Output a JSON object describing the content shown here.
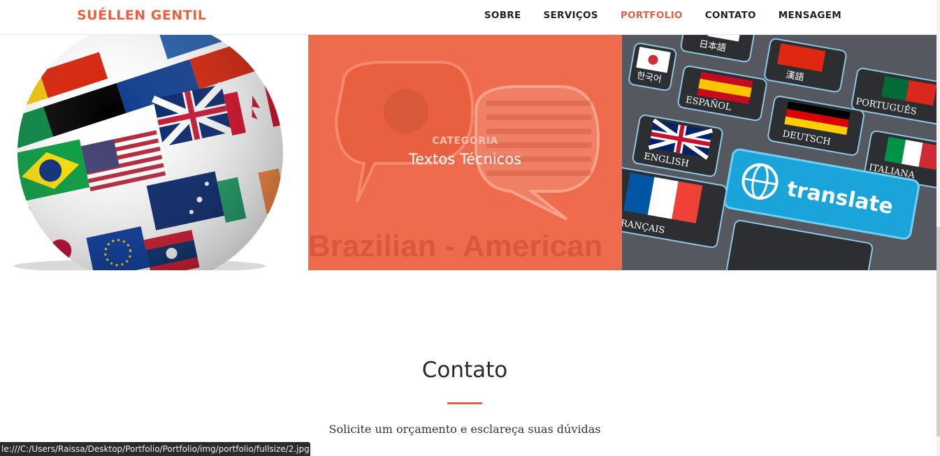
{
  "brand": "SUÉLLEN GENTIL",
  "nav": {
    "items": [
      "SOBRE",
      "SERVIÇOS",
      "PORTFOLIO",
      "CONTATO",
      "MENSAGEM"
    ],
    "active": "PORTFOLIO"
  },
  "portfolio": {
    "tiles": [
      {
        "image": "flags-globe-image"
      },
      {
        "image": "brazil-usa-speech-bubbles-image",
        "banner_text": "Brazilian - American",
        "category": "CATEGORIA",
        "title": "Textos Técnicos"
      },
      {
        "image": "translate-keyboard-image",
        "key_labels": [
          "日本語",
          "漢語",
          "PORTUGUÊS",
          "한국어",
          "ESPAÑOL",
          "DEUTSCH",
          "ITALIANA",
          "ENGLISH",
          "translate",
          "FRANÇAIS"
        ]
      }
    ]
  },
  "contato": {
    "title": "Contato",
    "subtitle": "Solicite um orçamento e esclareça suas dúvidas"
  },
  "status_bar": "le:///C:/Users/Raissa/Desktop/Portfolio/Portfolio/img/portfolio/fullsize/2.jpg",
  "colors": {
    "accent": "#e8623f",
    "overlay": "#ef6b4e"
  }
}
